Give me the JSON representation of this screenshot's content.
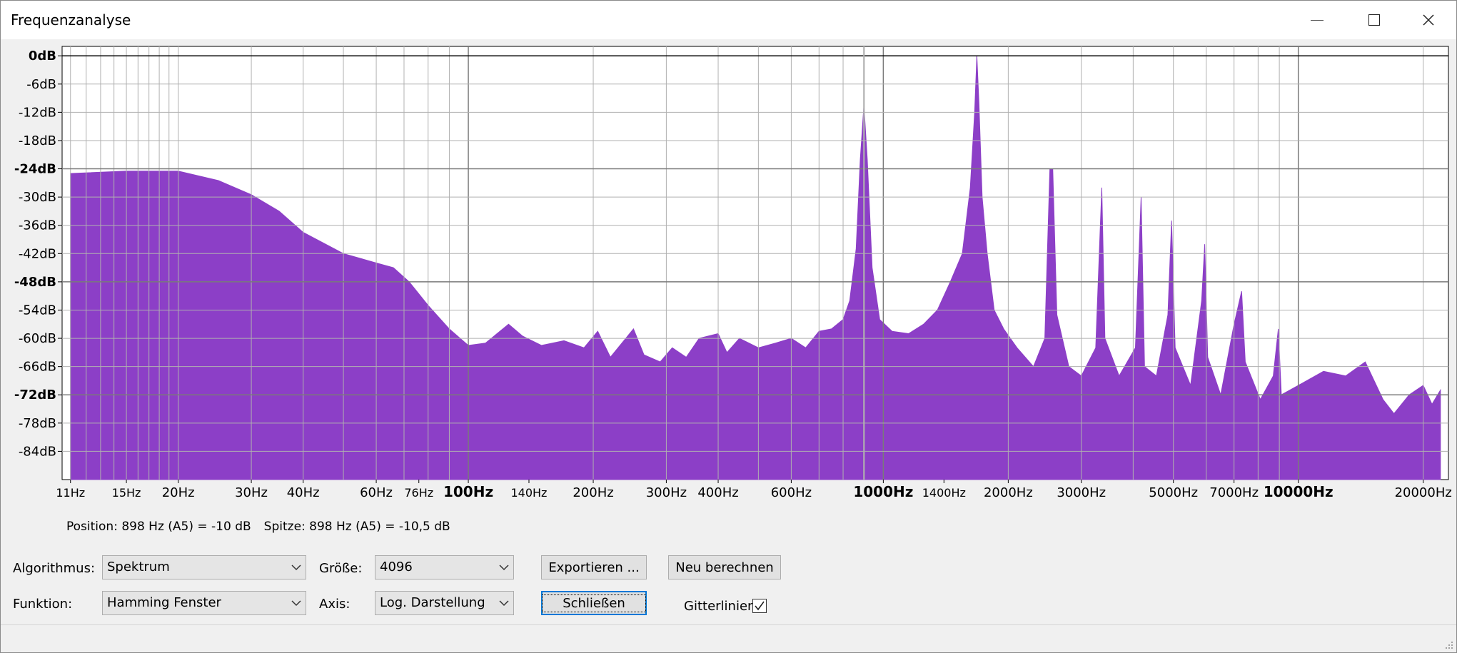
{
  "window": {
    "title": "Frequenzanalyse"
  },
  "status": {
    "position": "Position: 898 Hz (A5) = -10 dB",
    "peak": "Spitze: 898 Hz (A5) = -10,5 dB"
  },
  "controls": {
    "algorithm_label": "Algorithmus:",
    "algorithm_value": "Spektrum",
    "size_label": "Größe:",
    "size_value": "4096",
    "export_label": "Exportieren ...",
    "recalc_label": "Neu berechnen",
    "function_label": "Funktion:",
    "function_value": "Hamming Fenster",
    "axis_label": "Axis:",
    "axis_value": "Log. Darstellung",
    "close_label": "Schließen",
    "grid_label": "Gitterlinien",
    "grid_checked": true
  },
  "chart_data": {
    "type": "area",
    "title": "",
    "xlabel": "",
    "ylabel": "",
    "x_scale": "log",
    "xlim": [
      10.5,
      23000
    ],
    "ylim": [
      -90,
      2
    ],
    "grid": true,
    "fill_color": "#8c3fc7",
    "y_ticks": [
      {
        "label": "0dB",
        "value": 0,
        "bold": true
      },
      {
        "label": "-6dB",
        "value": -6
      },
      {
        "label": "-12dB",
        "value": -12
      },
      {
        "label": "-18dB",
        "value": -18
      },
      {
        "label": "-24dB",
        "value": -24,
        "bold": true
      },
      {
        "label": "-30dB",
        "value": -30
      },
      {
        "label": "-36dB",
        "value": -36
      },
      {
        "label": "-42dB",
        "value": -42
      },
      {
        "label": "-48dB",
        "value": -48,
        "bold": true
      },
      {
        "label": "-54dB",
        "value": -54
      },
      {
        "label": "-60dB",
        "value": -60
      },
      {
        "label": "-66dB",
        "value": -66
      },
      {
        "label": "-72dB",
        "value": -72,
        "bold": true
      },
      {
        "label": "-78dB",
        "value": -78
      },
      {
        "label": "-84dB",
        "value": -84
      }
    ],
    "x_ticks": [
      {
        "label": "11Hz",
        "value": 11,
        "size": "small"
      },
      {
        "label": "15Hz",
        "value": 15,
        "size": "small"
      },
      {
        "label": "20Hz",
        "value": 20
      },
      {
        "label": "30Hz",
        "value": 30
      },
      {
        "label": "40Hz",
        "value": 40
      },
      {
        "label": "60Hz",
        "value": 60
      },
      {
        "label": "76Hz",
        "value": 76,
        "size": "small"
      },
      {
        "label": "100Hz",
        "value": 100,
        "bold": true
      },
      {
        "label": "140Hz",
        "value": 140,
        "size": "small"
      },
      {
        "label": "200Hz",
        "value": 200
      },
      {
        "label": "300Hz",
        "value": 300
      },
      {
        "label": "400Hz",
        "value": 400
      },
      {
        "label": "600Hz",
        "value": 600
      },
      {
        "label": "1000Hz",
        "value": 1000,
        "bold": true
      },
      {
        "label": "1400Hz",
        "value": 1400,
        "size": "small"
      },
      {
        "label": "2000Hz",
        "value": 2000
      },
      {
        "label": "3000Hz",
        "value": 3000
      },
      {
        "label": "5000Hz",
        "value": 5000
      },
      {
        "label": "7000Hz",
        "value": 7000
      },
      {
        "label": "10000Hz",
        "value": 10000,
        "bold": true
      },
      {
        "label": "20000Hz",
        "value": 20000
      }
    ],
    "minor_grid_x": [
      11,
      12,
      13,
      14,
      15,
      16,
      17,
      18,
      19,
      20,
      30,
      40,
      50,
      60,
      70,
      80,
      90,
      100,
      200,
      300,
      400,
      500,
      600,
      700,
      800,
      900,
      1000,
      2000,
      3000,
      4000,
      5000,
      6000,
      7000,
      8000,
      9000,
      10000,
      20000
    ],
    "cursor_x": 898,
    "series": [
      {
        "values": [
          [
            11,
            -25
          ],
          [
            15,
            -24.5
          ],
          [
            20,
            -24.5
          ],
          [
            25,
            -26.5
          ],
          [
            30,
            -29.5
          ],
          [
            35,
            -33
          ],
          [
            40,
            -37.5
          ],
          [
            50,
            -42
          ],
          [
            60,
            -44
          ],
          [
            66,
            -45
          ],
          [
            72,
            -48
          ],
          [
            80,
            -53
          ],
          [
            90,
            -58
          ],
          [
            100,
            -61.5
          ],
          [
            110,
            -61
          ],
          [
            125,
            -57
          ],
          [
            135,
            -59.5
          ],
          [
            150,
            -61.5
          ],
          [
            170,
            -60.5
          ],
          [
            190,
            -62
          ],
          [
            205,
            -58.5
          ],
          [
            220,
            -64
          ],
          [
            250,
            -58
          ],
          [
            265,
            -63.5
          ],
          [
            290,
            -65
          ],
          [
            310,
            -62
          ],
          [
            335,
            -64
          ],
          [
            360,
            -60
          ],
          [
            400,
            -59
          ],
          [
            420,
            -63
          ],
          [
            450,
            -60
          ],
          [
            500,
            -62
          ],
          [
            550,
            -61
          ],
          [
            600,
            -60
          ],
          [
            650,
            -62
          ],
          [
            700,
            -58.5
          ],
          [
            750,
            -58
          ],
          [
            800,
            -56
          ],
          [
            830,
            -52
          ],
          [
            860,
            -41
          ],
          [
            880,
            -22
          ],
          [
            898,
            -10.5
          ],
          [
            915,
            -22
          ],
          [
            940,
            -45
          ],
          [
            980,
            -56
          ],
          [
            1050,
            -58.5
          ],
          [
            1150,
            -59
          ],
          [
            1250,
            -57
          ],
          [
            1350,
            -54
          ],
          [
            1450,
            -48
          ],
          [
            1550,
            -42
          ],
          [
            1620,
            -28
          ],
          [
            1660,
            -12
          ],
          [
            1680,
            0
          ],
          [
            1700,
            -10
          ],
          [
            1730,
            -30
          ],
          [
            1780,
            -42
          ],
          [
            1850,
            -54
          ],
          [
            1950,
            -58
          ],
          [
            2100,
            -62
          ],
          [
            2300,
            -66
          ],
          [
            2450,
            -60
          ],
          [
            2520,
            -24
          ],
          [
            2560,
            -24
          ],
          [
            2620,
            -55
          ],
          [
            2800,
            -66
          ],
          [
            3000,
            -68
          ],
          [
            3250,
            -62
          ],
          [
            3360,
            -28
          ],
          [
            3420,
            -60
          ],
          [
            3700,
            -68
          ],
          [
            4050,
            -62
          ],
          [
            4180,
            -30
          ],
          [
            4260,
            -66
          ],
          [
            4550,
            -68
          ],
          [
            4850,
            -55
          ],
          [
            4950,
            -35
          ],
          [
            5050,
            -62
          ],
          [
            5500,
            -70
          ],
          [
            5850,
            -52
          ],
          [
            5950,
            -40
          ],
          [
            6050,
            -64
          ],
          [
            6500,
            -72
          ],
          [
            7000,
            -57
          ],
          [
            7300,
            -50
          ],
          [
            7450,
            -65
          ],
          [
            8100,
            -73
          ],
          [
            8700,
            -68
          ],
          [
            8950,
            -58
          ],
          [
            9100,
            -72
          ],
          [
            10000,
            -70
          ],
          [
            11500,
            -67
          ],
          [
            13000,
            -68
          ],
          [
            14500,
            -65
          ],
          [
            16000,
            -73
          ],
          [
            17000,
            -76
          ],
          [
            18500,
            -72
          ],
          [
            20000,
            -70
          ],
          [
            21000,
            -74
          ],
          [
            22000,
            -71
          ]
        ]
      }
    ]
  }
}
